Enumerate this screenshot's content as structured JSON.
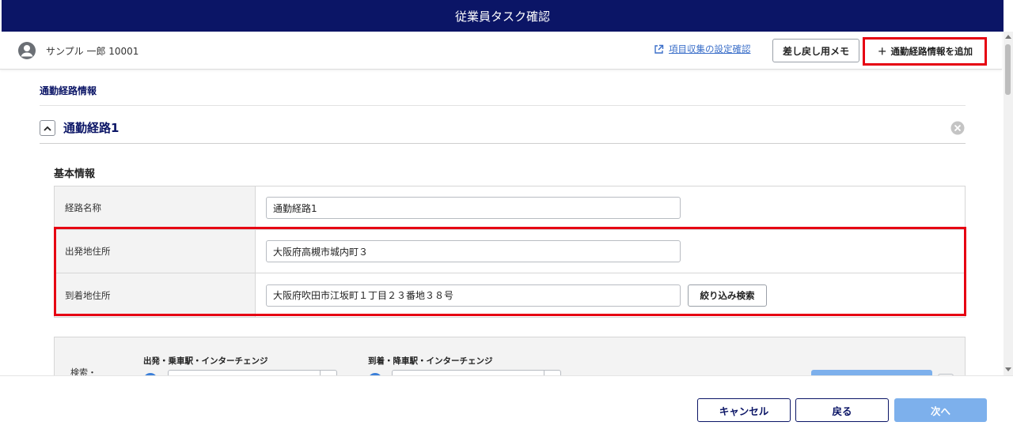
{
  "window": {
    "title": "従業員タスク確認"
  },
  "user": {
    "name": "サンプル 一郎 10001"
  },
  "toolbar": {
    "settings_link": "項目収集の設定確認",
    "memo_button": "差し戻し用メモ",
    "add_route_button": "通勤経路情報を追加",
    "add_icon": "＋"
  },
  "section": {
    "title": "通勤経路情報"
  },
  "route": {
    "title": "通勤経路1"
  },
  "basic_info": {
    "title": "基本情報",
    "fields": [
      {
        "label": "経路名称",
        "value": "通勤経路1"
      },
      {
        "label": "出発地住所",
        "value": "大阪府高槻市城内町３"
      },
      {
        "label": "到着地住所",
        "value": "大阪府吹田市江坂町１丁目２３番地３８号"
      }
    ],
    "filter_search_button": "絞り込み検索"
  },
  "search_panel": {
    "label": "検索・",
    "departure_label": "出発・乗車駅・インターチェンジ",
    "arrival_label": "到着・降車駅・インターチェンジ"
  },
  "footer": {
    "cancel": "キャンセル",
    "back": "戻る",
    "next": "次へ"
  },
  "colors": {
    "header_bg": "#0b1566",
    "accent_blue": "#7db0ec",
    "highlight_red": "#e60012",
    "link": "#3b6fc9"
  }
}
